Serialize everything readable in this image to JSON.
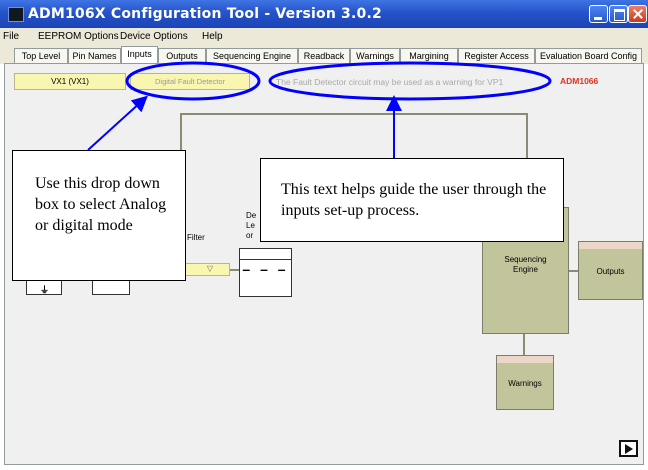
{
  "window": {
    "title": "ADM106X Configuration Tool - Version 3.0.2"
  },
  "menu": [
    "File",
    "EEPROM Options",
    "Device Options",
    "Help"
  ],
  "tabs": [
    {
      "label": "Top Level",
      "active": false
    },
    {
      "label": "Pin Names",
      "active": false
    },
    {
      "label": "Inputs",
      "active": true
    },
    {
      "label": "Outputs",
      "active": false
    },
    {
      "label": "Sequencing Engine",
      "active": false
    },
    {
      "label": "Readback",
      "active": false
    },
    {
      "label": "Warnings",
      "active": false
    },
    {
      "label": "Margining",
      "active": false
    },
    {
      "label": "Register Access",
      "active": false
    },
    {
      "label": "Evaluation Board Config",
      "active": false
    }
  ],
  "inputs": {
    "channel_value": "VX1 (VX1)",
    "mode_value": "Digital Fault Detector",
    "hint": "The Fault Detector circuit may be used as a warning for VP1",
    "device": "ADM1066"
  },
  "diagram": {
    "filter_label": "Filter",
    "delay_label": "De\nLe\nor",
    "delay_value": "– – –",
    "blocks": {
      "sequencing": "Sequencing\nEngine",
      "outputs": "Outputs",
      "warnings": "Warnings"
    }
  },
  "annotations": {
    "left": "Use this drop down box to select Analog or digital mode",
    "right": "This text helps guide the user through the inputs set-up process."
  },
  "colors": {
    "title_bar": "#2553c9",
    "field_yellow": "#f8f6b0",
    "block_olive": "#c2c49c",
    "annotation_blue": "#0000ff",
    "device_red": "#e0301e"
  },
  "icons": {
    "run": "play-icon"
  }
}
